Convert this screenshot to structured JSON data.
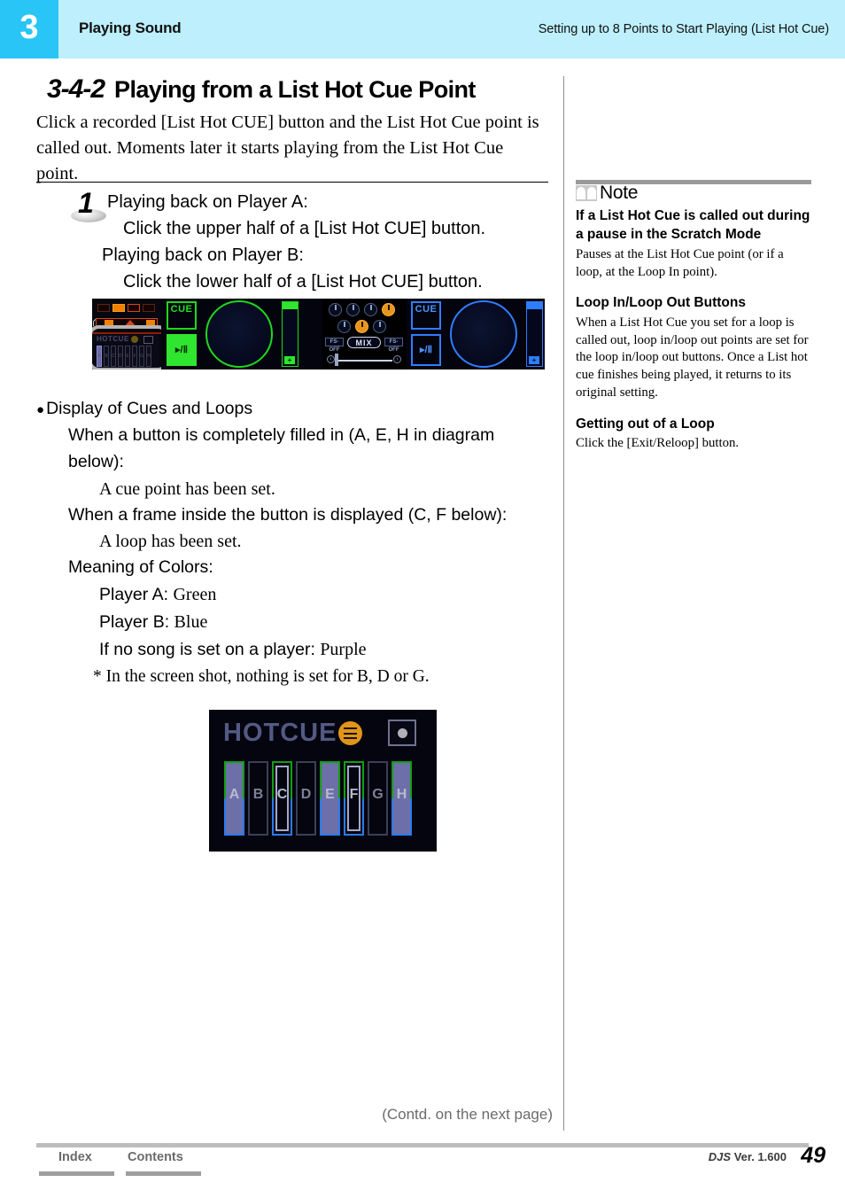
{
  "header": {
    "chapter_number": "3",
    "section_title": "Playing Sound",
    "topic_title": "Setting up to 8 Points to Start Playing (List Hot Cue)"
  },
  "title": {
    "number": "3-4-2",
    "text": "Playing from a List Hot Cue Point",
    "intro": "Click a recorded [List Hot CUE] button and the List Hot Cue point is called out. Moments later it starts playing from the List Hot Cue point."
  },
  "step1": {
    "number": "1",
    "line_a": "Playing back on Player A:",
    "line_a_detail": "Click the upper half of a [List Hot CUE] button.",
    "line_b": "Playing back on Player B:",
    "line_b_detail": "Click the lower half of a [List Hot CUE] button."
  },
  "dj_screenshot": {
    "deck_a": {
      "cue_label": "CUE",
      "play_label": "▸/Ⅱ",
      "fader_plus": "+"
    },
    "deck_b": {
      "cue_label": "CUE",
      "play_label": "▸/Ⅱ",
      "fader_plus": "+"
    },
    "center": {
      "mix_label": "MIX",
      "fs_left_label": "FS-OFF",
      "fs_right_label": "FS-OFF",
      "arrow_left": "‹",
      "arrow_right": "›"
    },
    "mini_hotcue": {
      "label": "HOTCUE",
      "pads": [
        "A",
        "B",
        "C",
        "D",
        "E",
        "F",
        "G",
        "H"
      ]
    }
  },
  "cues_section": {
    "bullet_heading": "Display of Cues and Loops",
    "line1": "When a button is completely filled in (A, E, H in diagram",
    "line2": "below):",
    "line1_detail": "A cue point has been set.",
    "line3": "When a frame inside the button is displayed (C, F below):",
    "line3_detail": "A loop has been set.",
    "colors_heading": "Meaning of Colors:",
    "player_a_label": "Player A: ",
    "player_a_color": "Green",
    "player_b_label": "Player B: ",
    "player_b_color": "Blue",
    "no_song_label": "If no song is set on a player: ",
    "no_song_color": "Purple",
    "footnote": "*  In the screen shot, nothing is set for B, D or G."
  },
  "hotcue_diagram": {
    "title": "HOTCUE",
    "pads": [
      {
        "letter": "A",
        "state": "set"
      },
      {
        "letter": "B",
        "state": "empty"
      },
      {
        "letter": "C",
        "state": "loop"
      },
      {
        "letter": "D",
        "state": "empty"
      },
      {
        "letter": "E",
        "state": "set"
      },
      {
        "letter": "F",
        "state": "loop"
      },
      {
        "letter": "G",
        "state": "empty"
      },
      {
        "letter": "H",
        "state": "set"
      }
    ]
  },
  "note": {
    "label": "Note",
    "sub1": "If a List Hot Cue is called out during a pause in the Scratch Mode",
    "body1": "Pauses at the List Hot Cue point (or if a loop, at the Loop In point).",
    "sub2": "Loop In/Loop Out Buttons",
    "body2": "When a List Hot Cue you set for a loop is called out, loop in/loop out points are set for the loop in/loop out buttons. Once a List hot cue finishes being played, it returns to its original setting.",
    "sub3": "Getting out of a Loop",
    "body3": "Click the [Exit/Reloop] button."
  },
  "footer": {
    "contd": "(Contd. on the next page)",
    "index": "Index",
    "contents": "Contents",
    "version_app": "DJS",
    "version_text": " Ver. 1.600",
    "page_number": "49"
  },
  "colors": {
    "header_band": "#bdeffc",
    "chapter_badge": "#29c5f6",
    "player_a_green": "#1fd81f",
    "player_b_blue": "#2f7dff",
    "no_song_purple": "#6d6fa8",
    "accent_orange": "#e0951a"
  }
}
